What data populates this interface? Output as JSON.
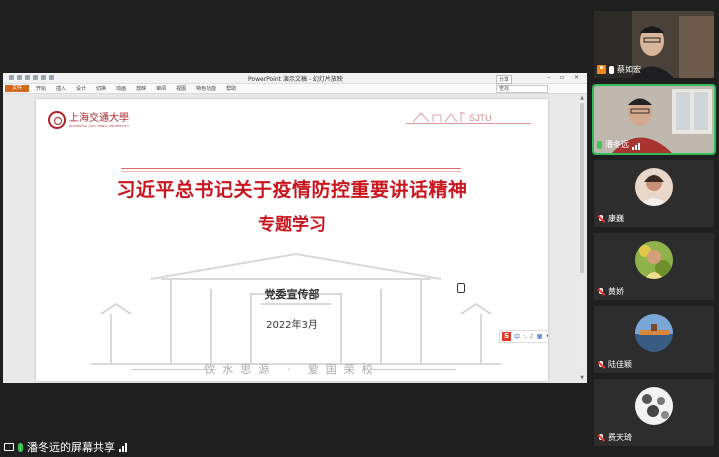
{
  "shared_window": {
    "app_title": "PowerPoint 演示文稿 - 幻灯片放映",
    "file_tab": "文件",
    "ribbon_tabs": [
      "开始",
      "插入",
      "设计",
      "切换",
      "动画",
      "放映",
      "审阅",
      "视图",
      "特色功能",
      "帮助"
    ],
    "search_placeholder": "查找",
    "share_button": "分享"
  },
  "slide": {
    "university_name": "上海交通大學",
    "university_en": "SHANGHAI JIAO TONG UNIVERSITY",
    "brand_mark": "SJTU",
    "title": "习近平总书记关于疫情防控重要讲话精神",
    "subtitle": "专题学习",
    "department": "党委宣传部",
    "date": "2022年3月",
    "motto": "饮水思源 · 爱国荣校"
  },
  "ime": {
    "logo": "S",
    "mode": "中"
  },
  "share_bar": {
    "label": "潘冬远的屏幕共享"
  },
  "participants": [
    {
      "name": "蔡如宏",
      "video": true,
      "mic": "on",
      "host": true
    },
    {
      "name": "潘冬远",
      "video": true,
      "mic": "on",
      "active": true
    },
    {
      "name": "康巍",
      "video": false,
      "mic": "off"
    },
    {
      "name": "黄娇",
      "video": false,
      "mic": "off"
    },
    {
      "name": "陆佳颖",
      "video": false,
      "mic": "off"
    },
    {
      "name": "费天琦",
      "video": false,
      "mic": "off"
    }
  ],
  "colors": {
    "accent_red": "#c9151e",
    "active_green": "#2fbe5a",
    "host_orange": "#f08a1c"
  }
}
